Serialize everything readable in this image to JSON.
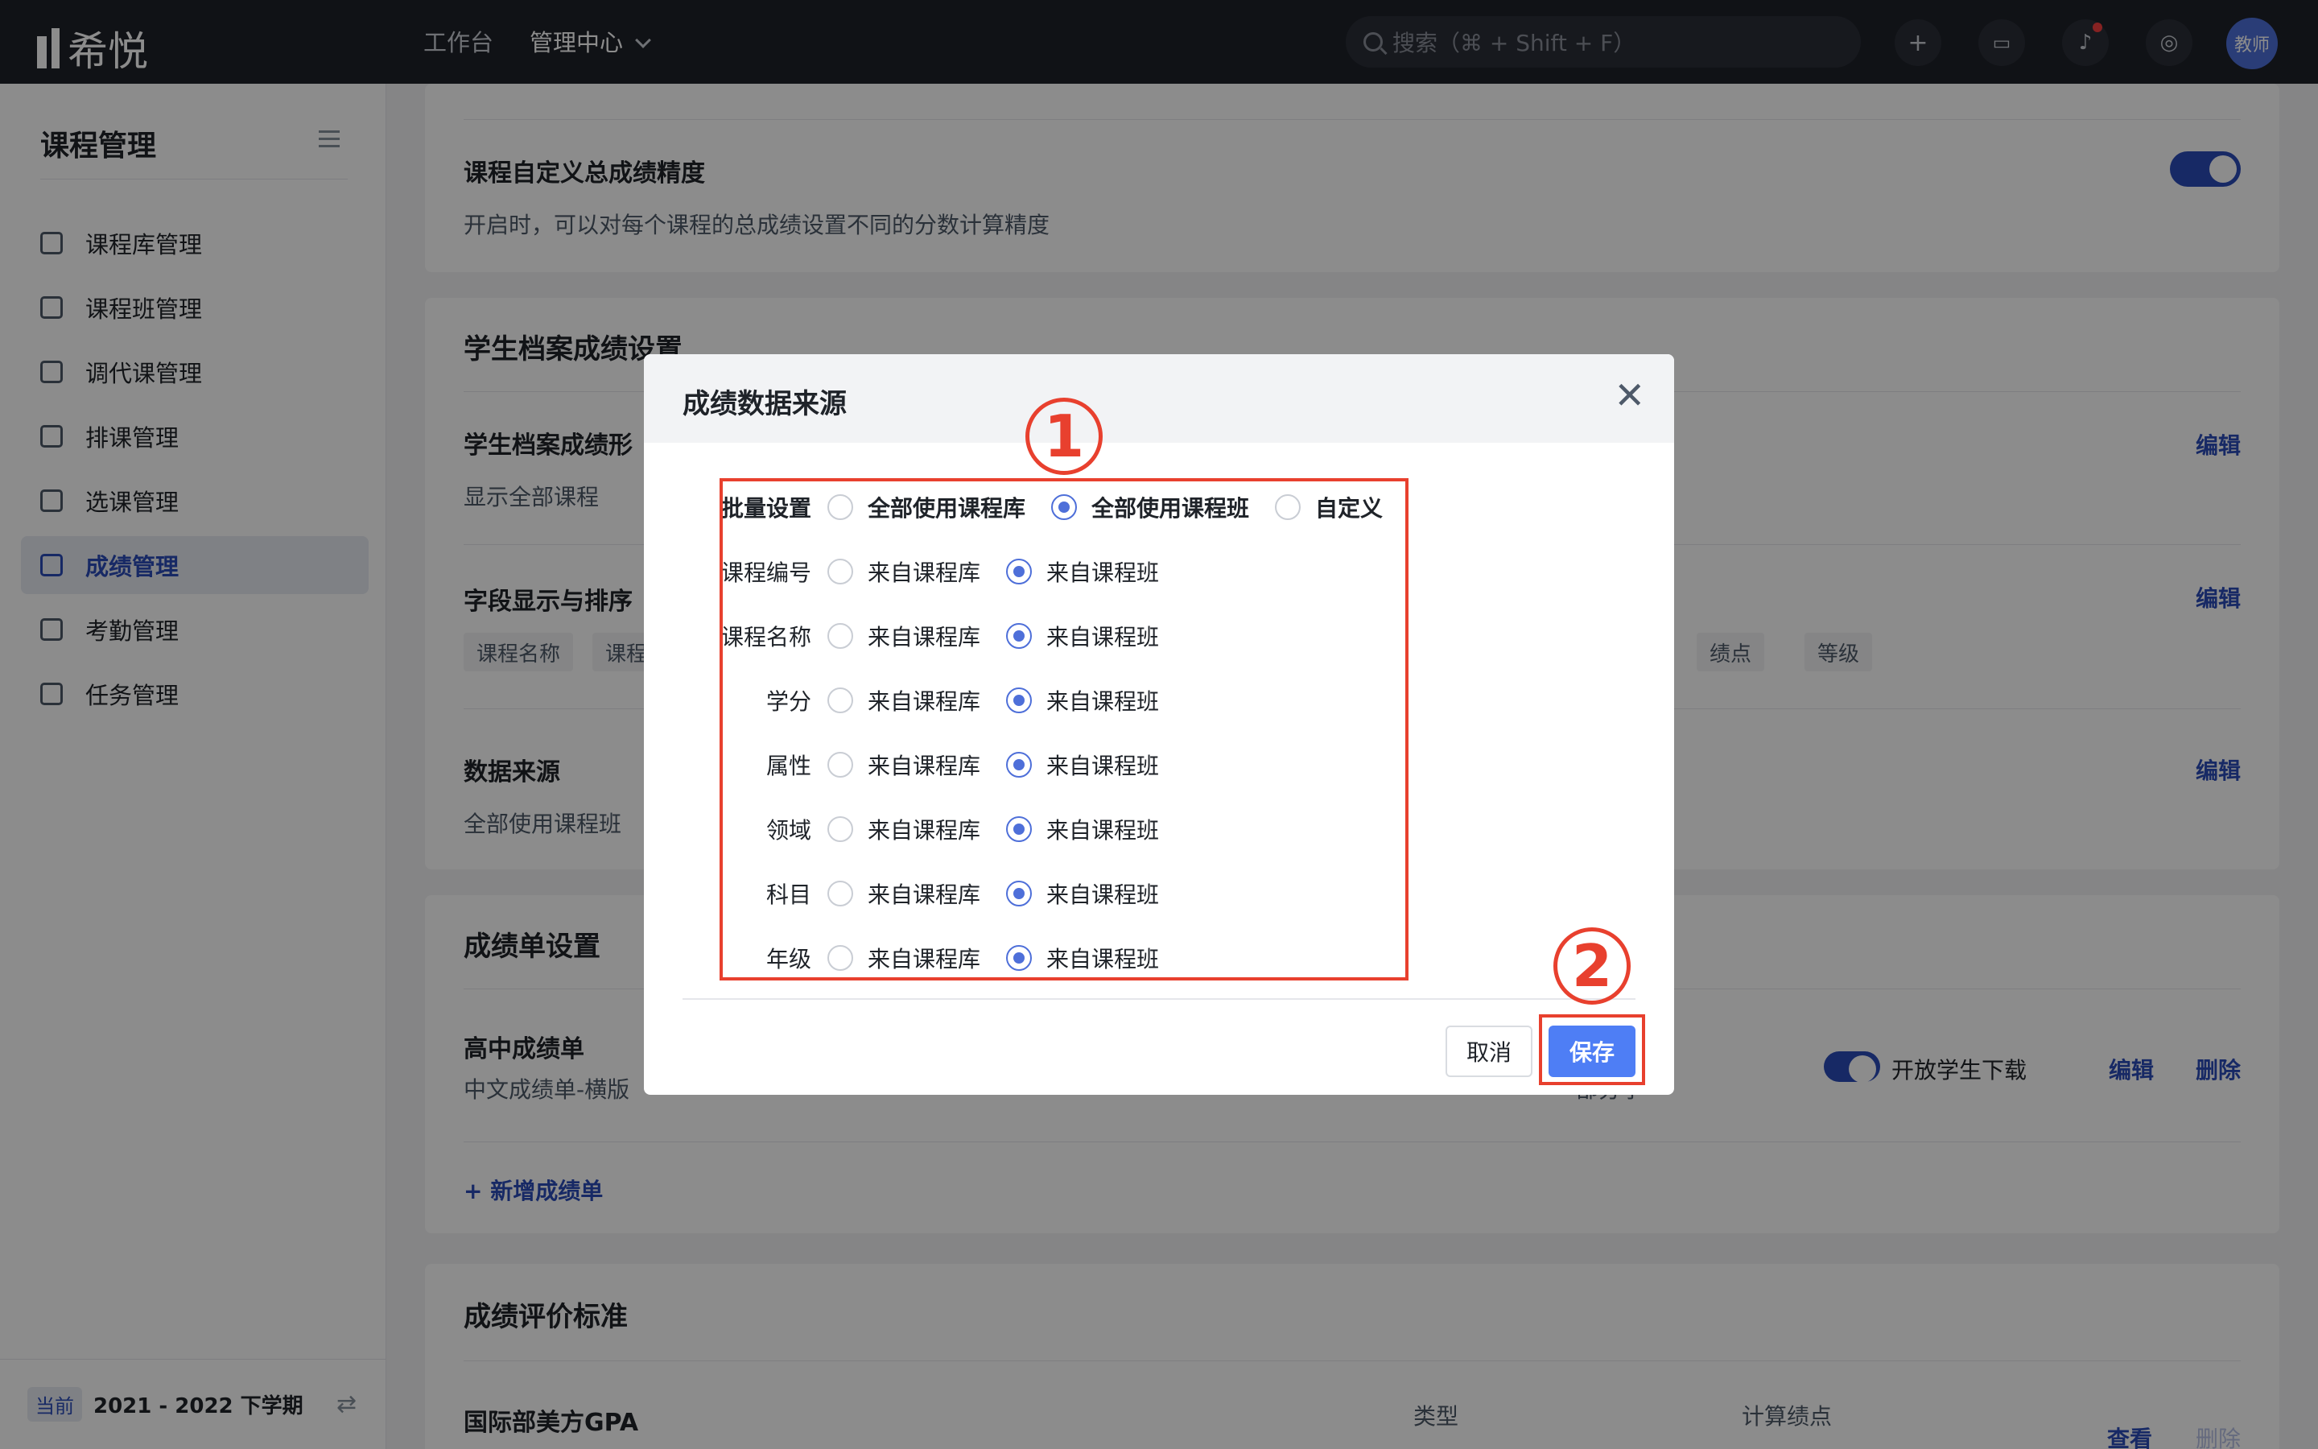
{
  "app": {
    "name": "希悦"
  },
  "topbar": {
    "nav": [
      "工作台",
      "管理中心"
    ],
    "search_placeholder": "搜索（⌘ + Shift + F）",
    "avatar_label": "教师"
  },
  "sidebar": {
    "title": "课程管理",
    "items": [
      {
        "label": "课程库管理"
      },
      {
        "label": "课程班管理"
      },
      {
        "label": "调代课管理"
      },
      {
        "label": "排课管理"
      },
      {
        "label": "选课管理"
      },
      {
        "label": "成绩管理"
      },
      {
        "label": "考勤管理"
      },
      {
        "label": "任务管理"
      }
    ],
    "term_badge": "当前",
    "term": "2021 - 2022 下学期"
  },
  "main": {
    "precision": {
      "title": "课程自定义总成绩精度",
      "desc": "开启时，可以对每个课程的总成绩设置不同的分数计算精度"
    },
    "archive": {
      "section": "学生档案成绩设置",
      "form_title": "学生档案成绩形",
      "form_desc": "显示全部课程",
      "field_title": "字段显示与排序",
      "tags_left": [
        "课程名称",
        "课程"
      ],
      "tags_right": [
        "绩点",
        "等级"
      ],
      "source_title": "数据来源",
      "source_desc": "全部使用课程班",
      "edit": "编辑"
    },
    "report": {
      "section": "成绩单设置",
      "item_title": "高中成绩单",
      "item_desc": "中文成绩单-横版",
      "item_extra": "部分字",
      "download_label": "开放学生下载",
      "edit": "编辑",
      "delete": "删除",
      "add": "新增成绩单"
    },
    "standard": {
      "section": "成绩评价标准",
      "item_title": "国际部美方GPA",
      "col_type": "类型",
      "col_gpa": "计算绩点",
      "view": "查看",
      "delete": "删除"
    }
  },
  "modal": {
    "title": "成绩数据来源",
    "batch_label": "批量设置",
    "batch_options": [
      "全部使用课程库",
      "全部使用课程班",
      "自定义"
    ],
    "batch_selected": 1,
    "option_lib": "来自课程库",
    "option_class": "来自课程班",
    "fields": [
      {
        "label": "课程编号",
        "selected": "class"
      },
      {
        "label": "课程名称",
        "selected": "class"
      },
      {
        "label": "学分",
        "selected": "class"
      },
      {
        "label": "属性",
        "selected": "class"
      },
      {
        "label": "领域",
        "selected": "class"
      },
      {
        "label": "科目",
        "selected": "class"
      },
      {
        "label": "年级",
        "selected": "class"
      }
    ],
    "cancel": "取消",
    "save": "保存"
  },
  "annotations": [
    "①",
    "②"
  ],
  "colors": {
    "accent": "#2b4cb8",
    "primary_button": "#4e7ef5",
    "annotation": "#e8402e"
  }
}
